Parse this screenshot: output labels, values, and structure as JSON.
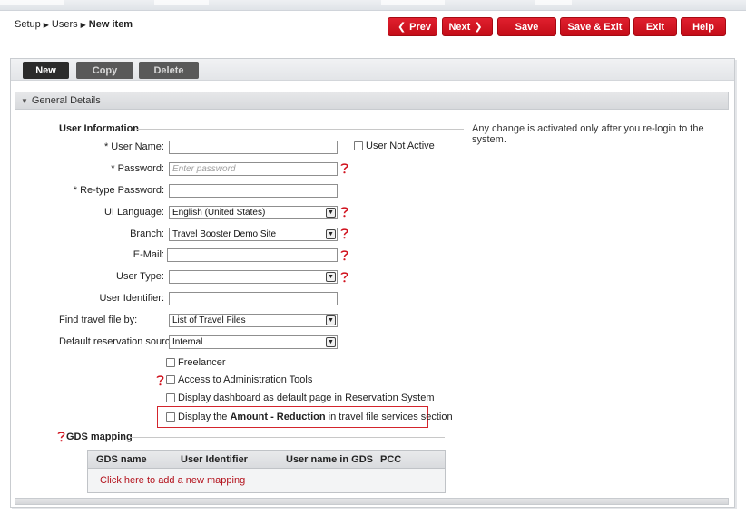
{
  "breadcrumb": {
    "level1": "Setup",
    "level2": "Users",
    "current": "New item"
  },
  "top_actions": {
    "prev": "Prev",
    "next": "Next",
    "save": "Save",
    "save_exit": "Save & Exit",
    "exit": "Exit",
    "help": "Help"
  },
  "toolbar": {
    "new": "New",
    "copy": "Copy",
    "delete": "Delete"
  },
  "section": {
    "title": "General Details"
  },
  "user_info": {
    "title": "User Information",
    "notice": "Any change is activated only after you re-login to the system.",
    "user_name_label": "* User Name:",
    "user_name_value": "",
    "user_not_active": "User Not Active",
    "password_label": "* Password:",
    "password_placeholder": "Enter password",
    "retype_label": "* Re-type Password:",
    "ui_language_label": "UI Language:",
    "ui_language_value": "English (United States)",
    "branch_label": "Branch:",
    "branch_value": "Travel Booster Demo Site",
    "email_label": "E-Mail:",
    "user_type_label": "User Type:",
    "user_type_value": "",
    "user_identifier_label": "User Identifier:",
    "find_travel_label": "Find travel file by:",
    "find_travel_value": "List of Travel Files",
    "default_source_label": "Default reservation source:",
    "default_source_value": "Internal",
    "freelancer": "Freelancer",
    "admin_tools": "Access to Administration Tools",
    "dashboard_default": "Display dashboard as default page in Reservation System",
    "amount_pre": "Display the ",
    "amount_bold": "Amount - Reduction",
    "amount_post": " in travel file services section"
  },
  "gds": {
    "title": "GDS mapping",
    "columns": [
      "GDS name",
      "User Identifier",
      "User name in GDS",
      "PCC"
    ],
    "add_link": "Click here to add a new mapping"
  },
  "colors": {
    "accent_red": "#d0101c",
    "link_red": "#b3121c"
  }
}
